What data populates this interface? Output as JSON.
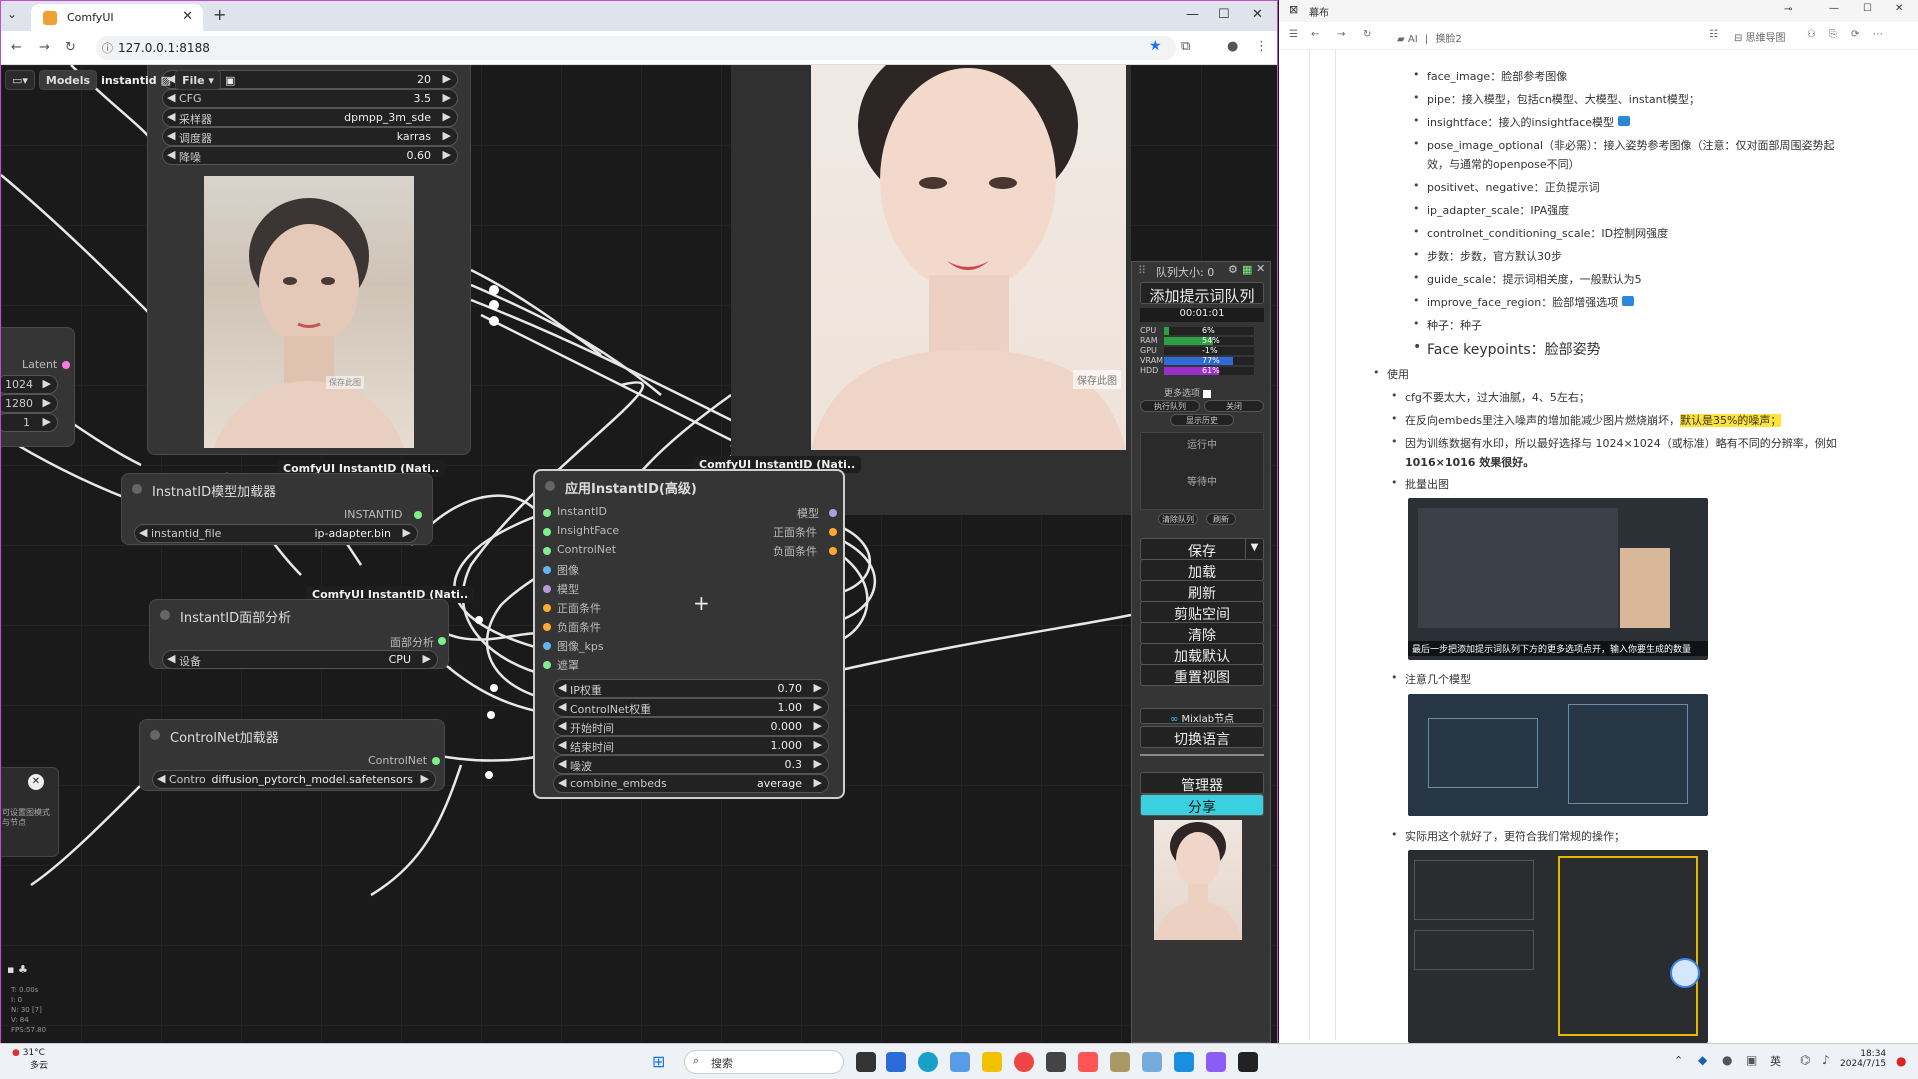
{
  "browser": {
    "tab_title": "ComfyUI",
    "url": "127.0.0.1:8188"
  },
  "comfy": {
    "menu": {
      "models": "Models",
      "workflow": "instantid",
      "file": "File"
    },
    "sampler_node": {
      "steps_value": "20",
      "cfg_label": "CFG",
      "cfg_value": "3.5",
      "sampler_label": "采样器",
      "sampler_value": "dpmpp_3m_sde",
      "scheduler_label": "调度器",
      "scheduler_value": "karras",
      "denoise_label": "降噪",
      "denoise_value": "0.60"
    },
    "latent_node": {
      "output_label": "Latent",
      "width": "1024",
      "height": "1280",
      "batch": "1"
    },
    "loader_node": {
      "badge": "ComfyUI InstantID (Nati..",
      "title": "InstnatID模型加载器",
      "output": "INSTANTID",
      "file_label": "instantid_file",
      "file_value": "ip-adapter.bin"
    },
    "face_node": {
      "badge": "ComfyUI InstantID (Nati..",
      "title": "InstantID面部分析",
      "output": "面部分析",
      "device_label": "设备",
      "device_value": "CPU"
    },
    "controlnet_node": {
      "title": "ControlNet加载器",
      "output": "ControlNet",
      "name_label": "Contro",
      "name_value": "diffusion_pytorch_model.safetensors"
    },
    "apply_node": {
      "badge": "ComfyUI InstantID (Nati..",
      "title": "应用InstantID(高级)",
      "inputs": [
        "InstantID",
        "InsightFace",
        "ControlNet",
        "图像",
        "模型",
        "正面条件",
        "负面条件",
        "图像_kps",
        "遮罩"
      ],
      "outputs": [
        "模型",
        "正面条件",
        "负面条件"
      ],
      "widgets": [
        {
          "label": "IP权重",
          "value": "0.70"
        },
        {
          "label": "ControlNet权重",
          "value": "1.00"
        },
        {
          "label": "开始时间",
          "value": "0.000"
        },
        {
          "label": "结束时间",
          "value": "1.000"
        },
        {
          "label": "噪波",
          "value": "0.3"
        },
        {
          "label": "combine_embeds",
          "value": "average"
        }
      ]
    },
    "preview_overlay_text": "保存此图",
    "side_note": "可设置图模式 与节点",
    "stats": [
      "T: 0.00s",
      "I: 0",
      "N: 30 [7]",
      "V: 84",
      "FPS:57.80"
    ]
  },
  "queue": {
    "header": "队列大小: 0",
    "add_btn": "添加提示词队列",
    "timer": "00:01:01",
    "stats": [
      {
        "name": "CPU",
        "pct": "6%",
        "value": 6,
        "color": "#2ea043"
      },
      {
        "name": "RAM",
        "pct": "54%",
        "value": 54,
        "color": "#2ea043"
      },
      {
        "name": "GPU",
        "pct": "-1%",
        "value": 0,
        "color": "#2ea043"
      },
      {
        "name": "VRAM",
        "pct": "77%",
        "value": 77,
        "color": "#2f6bd8"
      },
      {
        "name": "HDD",
        "pct": "61%",
        "value": 61,
        "color": "#9b30c9"
      }
    ],
    "more_options": "更多选项",
    "exec_queue": "执行队列",
    "close": "关闭",
    "show_history": "显示历史",
    "running": "运行中",
    "waiting": "等待中",
    "clear_queue": "清除队列",
    "refresh_small": "刷新",
    "buttons": [
      "保存",
      "加载",
      "刷新",
      "剪贴空间",
      "清除",
      "加载默认",
      "重置视图"
    ],
    "mixlab": "Mixlab节点",
    "switch_lang": "切换语言",
    "manager": "管理器",
    "share": "分享",
    "colors": {
      "share": "#39d0e0"
    }
  },
  "notes": {
    "window_title": "幕布",
    "breadcrumb_ai": "AI",
    "breadcrumb_2": "换脸2",
    "toolbar_mindmap": "思维导图",
    "items": [
      "face_image：脸部参考图像",
      "pipe：接入模型，包括cn模型、大模型、instant模型；",
      "insightface：接入的insightface模型",
      "pose_image_optional（非必需）：接入姿势参考图像（注意：仅对面部周围姿势起",
      "效，与通常的openpose不同）",
      "positivet、negative：正负提示词",
      "ip_adapter_scale：IPA强度",
      "controlnet_conditioning_scale：ID控制网强度",
      "步数：步数，官方默认30步",
      "guide_scale：提示词相关度，一般默认为5",
      "improve_face_region：脸部增强选项",
      "种子：种子"
    ],
    "face_keypoints": "Face keypoints：脸部姿势",
    "use": "使用",
    "use_items": [
      "cfg不要太大，过大油腻，4、5左右；",
      "在反向embeds里注入噪声的增加能减少图片燃烧崩坏，",
      "默认是35%的噪声；",
      "因为训练数据有水印，所以最好选择与 1024×1024（或标准）略有不同的分辨率，例如",
      "1016×1016 效果很好。",
      "批量出图"
    ],
    "caption1": "最后一步把添加提示词队列下方的更多选项点开，输入你要生成的数量",
    "models_note": "注意几个模型",
    "practical_note": "实际用这个就好了，更符合我们常规的操作；"
  },
  "taskbar": {
    "weather_temp": "31°C",
    "weather_desc": "多云",
    "search": "搜索",
    "time": "18:34",
    "date": "2024/7/15",
    "ime": "英"
  }
}
